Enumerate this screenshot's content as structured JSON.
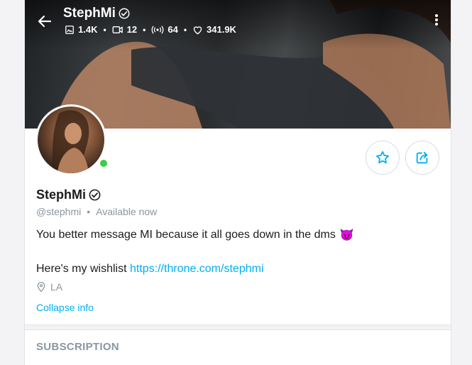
{
  "profile": {
    "display_name": "StephMi",
    "handle": "@stephmi",
    "status": "Available now",
    "verified": true,
    "online": true
  },
  "stats": {
    "photos": "1.4K",
    "videos": "12",
    "streams": "64",
    "likes": "341.9K"
  },
  "bio": {
    "line1": "You better message MI because it all goes down in the dms",
    "emoji": "😈",
    "line2_prefix": "Here's my wishlist",
    "link": "https://throne.com/stephmi"
  },
  "location": "LA",
  "collapse_label": "Collapse info",
  "subscription_heading": "SUBSCRIPTION",
  "colors": {
    "accent": "#00aff0",
    "online": "#3ccb4a",
    "muted": "#8a96a3"
  },
  "icons": [
    "back-arrow-icon",
    "verified-icon",
    "image-icon",
    "video-icon",
    "stream-icon",
    "heart-icon",
    "more-vertical-icon",
    "star-icon",
    "share-icon",
    "location-pin-icon"
  ]
}
